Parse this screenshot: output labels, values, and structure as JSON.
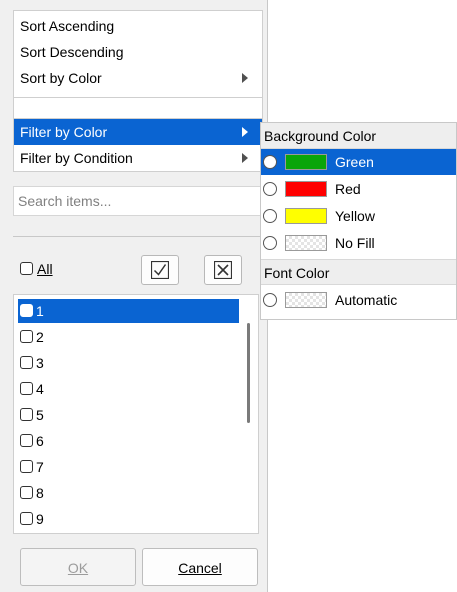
{
  "sort_menu": {
    "items": [
      {
        "label": "Sort Ascending"
      },
      {
        "label": "Sort Descending"
      },
      {
        "label": "Sort by Color"
      }
    ]
  },
  "filter_menu": {
    "items": [
      {
        "label": "Filter by Color"
      },
      {
        "label": "Filter by Condition"
      }
    ]
  },
  "search": {
    "placeholder": "Search items...",
    "value": ""
  },
  "select_all": {
    "label": "All",
    "checked": false
  },
  "list": {
    "items": [
      "1",
      "2",
      "3",
      "4",
      "5",
      "6",
      "7",
      "8",
      "9"
    ],
    "selected_index": 0
  },
  "buttons": {
    "ok": {
      "label": "OK",
      "disabled": true
    },
    "cancel": {
      "label": "Cancel"
    }
  },
  "color_submenu": {
    "background_header": "Background Color",
    "background_items": [
      {
        "label": "Green",
        "color": "#0aa50a"
      },
      {
        "label": "Red",
        "color": "#ff0000"
      },
      {
        "label": "Yellow",
        "color": "#ffff00"
      },
      {
        "label": "No Fill",
        "color": "none"
      }
    ],
    "font_header": "Font Color",
    "font_items": [
      {
        "label": "Automatic",
        "color": "none"
      }
    ]
  },
  "colors": {
    "selection": "#0a64d2",
    "panel_bg": "#f0f0f0"
  },
  "icons": {
    "check_all": "check-icon",
    "uncheck_all": "x-box-icon"
  }
}
